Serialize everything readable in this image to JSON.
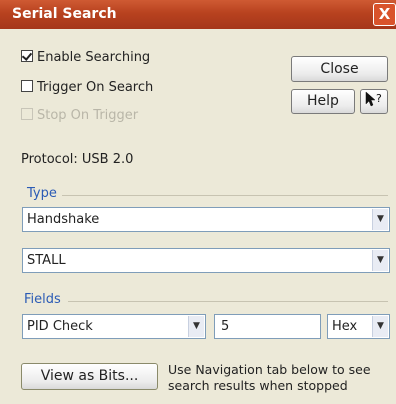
{
  "window": {
    "title": "Serial Search",
    "close_glyph": "X"
  },
  "options": {
    "enable_searching": {
      "label": "Enable Searching",
      "checked": true
    },
    "trigger_on_search": {
      "label": "Trigger On Search",
      "checked": false
    },
    "stop_on_trigger": {
      "label": "Stop On Trigger",
      "checked": false,
      "enabled": false
    }
  },
  "buttons": {
    "close": "Close",
    "help": "Help",
    "whats_this_icon": "pointer-question-icon",
    "view_as_bits": "View as Bits..."
  },
  "protocol_text": "Protocol: USB 2.0",
  "type_section": {
    "heading": "Type",
    "type_value": "Handshake",
    "handshake_value": "STALL"
  },
  "fields_section": {
    "heading": "Fields",
    "field_value": "PID Check",
    "value_input": "5",
    "radix_value": "Hex"
  },
  "hint_line1": "Use Navigation tab below to see",
  "hint_line2": "search results when stopped",
  "colors": {
    "title_bar": "#b8421f",
    "section_heading": "#2b5bb5",
    "window_bg": "#ece9d8"
  }
}
